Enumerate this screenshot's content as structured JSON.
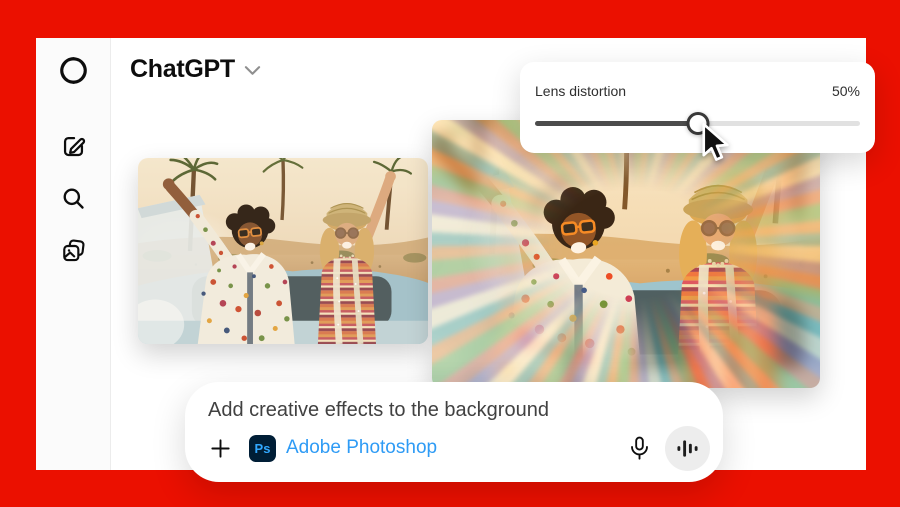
{
  "header": {
    "title": "ChatGPT"
  },
  "sidebar": {
    "items": [
      {
        "id": "openai-logo"
      },
      {
        "id": "new-chat"
      },
      {
        "id": "search"
      },
      {
        "id": "library"
      }
    ]
  },
  "effect_panel": {
    "label": "Lens distortion",
    "value": "50%",
    "percent": 50
  },
  "photos": {
    "original_alt": "Two friends laughing in a convertible among palm trees",
    "distorted_alt": "Same photo with radial lens-distortion blur applied"
  },
  "composer": {
    "prompt": "Add creative effects to the background",
    "add_label": "+",
    "plugin_badge": "Ps",
    "plugin_name": "Adobe Photoshop"
  },
  "colors": {
    "accent_red": "#EB1000",
    "ps_badge_bg": "#001E36",
    "ps_badge_text": "#31A8FF",
    "link_blue": "#2E9BF5",
    "slider_fill": "#4c4c4c"
  }
}
